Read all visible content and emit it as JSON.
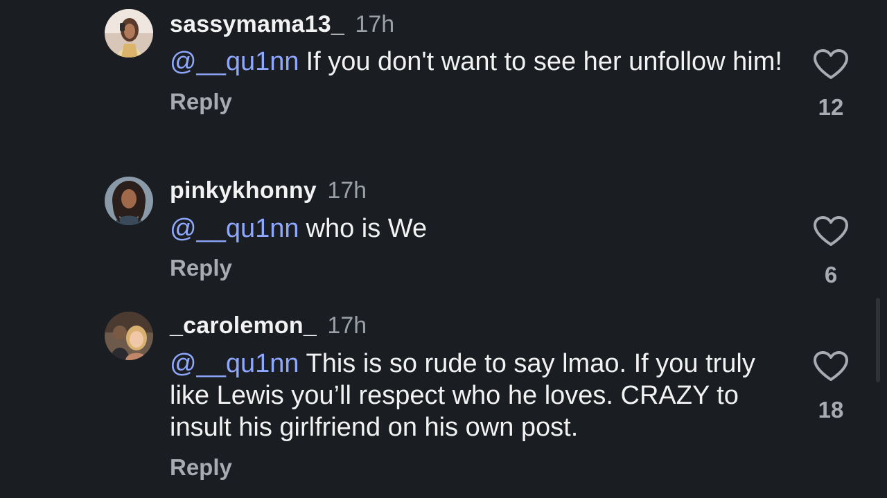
{
  "comments": [
    {
      "username": "sassymama13_",
      "time": "17h",
      "mention": "@__qu1nn",
      "text": "If you don't want to see her unfollow him!",
      "reply_label": "Reply",
      "like_count": "12",
      "avatar_icon": "user-avatar-photo"
    },
    {
      "username": "pinkykhonny",
      "time": "17h",
      "mention": "@__qu1nn",
      "text": "who is We",
      "reply_label": "Reply",
      "like_count": "6",
      "avatar_icon": "user-avatar-photo"
    },
    {
      "username": "_carolemon_",
      "time": "17h",
      "mention": "@__qu1nn",
      "text": "This is so rude to say lmao. If you truly like Lewis you’ll respect who he loves. CRAZY to insult his girlfriend on his own post.",
      "reply_label": "Reply",
      "like_count": "18",
      "avatar_icon": "user-avatar-photo"
    }
  ],
  "colors": {
    "background": "#1a1d21",
    "mention": "#8fa8ff",
    "secondary_text": "#a8acb2"
  }
}
